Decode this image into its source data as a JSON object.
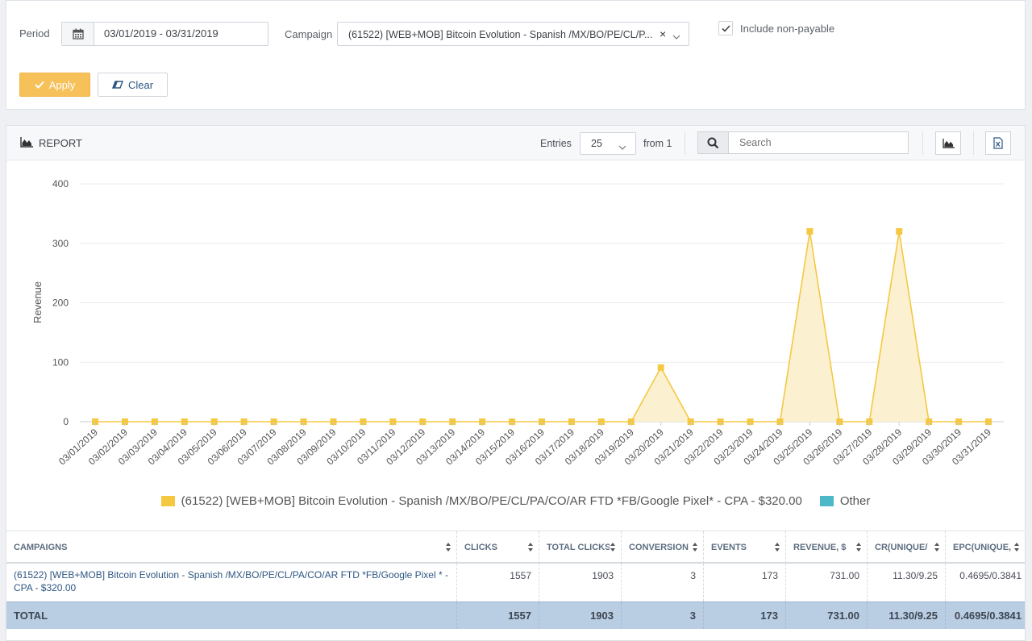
{
  "filters": {
    "period_label": "Period",
    "period_value": "03/01/2019 - 03/31/2019",
    "campaign_label": "Campaign",
    "campaign_value": "(61522) [WEB+MOB] Bitcoin Evolution - Spanish /MX/BO/PE/CL/P...",
    "clear_x": "×",
    "include_nonpayable_label": "Include non-payable",
    "include_nonpayable_checked": true,
    "apply_label": "Apply",
    "clear_label": "Clear"
  },
  "report": {
    "title": "REPORT",
    "entries_label": "Entries",
    "entries_value": "25",
    "from_label": "from 1",
    "search_placeholder": "Search"
  },
  "colors": {
    "series": "#f5c842",
    "series_fill": "#fbf1d0",
    "other": "#4db8c8",
    "apply": "#f7c15a",
    "total_row": "#b9cde3",
    "link": "#2e5683"
  },
  "chart_data": {
    "type": "area",
    "ylabel": "Revenue",
    "ylim": [
      0,
      400
    ],
    "yticks": [
      "0",
      "100",
      "200",
      "300",
      "400"
    ],
    "x": [
      "03/01/2019",
      "03/02/2019",
      "03/03/2019",
      "03/04/2019",
      "03/05/2019",
      "03/06/2019",
      "03/07/2019",
      "03/08/2019",
      "03/09/2019",
      "03/10/2019",
      "03/11/2019",
      "03/12/2019",
      "03/13/2019",
      "03/14/2019",
      "03/15/2019",
      "03/16/2019",
      "03/17/2019",
      "03/18/2019",
      "03/19/2019",
      "03/20/2019",
      "03/21/2019",
      "03/22/2019",
      "03/23/2019",
      "03/24/2019",
      "03/25/2019",
      "03/26/2019",
      "03/27/2019",
      "03/28/2019",
      "03/29/2019",
      "03/30/2019",
      "03/31/2019"
    ],
    "series": [
      {
        "name": "(61522) [WEB+MOB] Bitcoin Evolution - Spanish /MX/BO/PE/CL/PA/CO/AR FTD *FB/Google Pixel* - CPA - $320.00",
        "values": [
          0,
          0,
          0,
          0,
          0,
          0,
          0,
          0,
          0,
          0,
          0,
          0,
          0,
          0,
          0,
          0,
          0,
          0,
          0,
          91,
          0,
          0,
          0,
          0,
          320,
          0,
          0,
          320,
          0,
          0,
          0
        ]
      }
    ],
    "legend": [
      {
        "label": "(61522) [WEB+MOB] Bitcoin Evolution - Spanish /MX/BO/PE/CL/PA/CO/AR FTD *FB/Google Pixel* - CPA - $320.00"
      },
      {
        "label": "Other"
      }
    ],
    "legend_position": "bottom"
  },
  "table": {
    "headers": [
      "CAMPAIGNS",
      "CLICKS",
      "TOTAL CLICKS",
      "CONVERSION",
      "EVENTS",
      "REVENUE, $",
      "CR(UNIQUE/",
      "EPC(UNIQUE,"
    ],
    "row": {
      "campaign": "(61522) [WEB+MOB] Bitcoin Evolution - Spanish /MX/BO/PE/CL/PA/CO/AR FTD *FB/Google Pixel * - CPA - $320.00",
      "clicks": "1557",
      "total_clicks": "1903",
      "conversion": "3",
      "events": "173",
      "revenue": "731.00",
      "cr": "11.30/9.25",
      "epc": "0.4695/0.3841"
    },
    "total": {
      "label": "TOTAL",
      "clicks": "1557",
      "total_clicks": "1903",
      "conversion": "3",
      "events": "173",
      "revenue": "731.00",
      "cr": "11.30/9.25",
      "epc": "0.4695/0.3841"
    }
  }
}
